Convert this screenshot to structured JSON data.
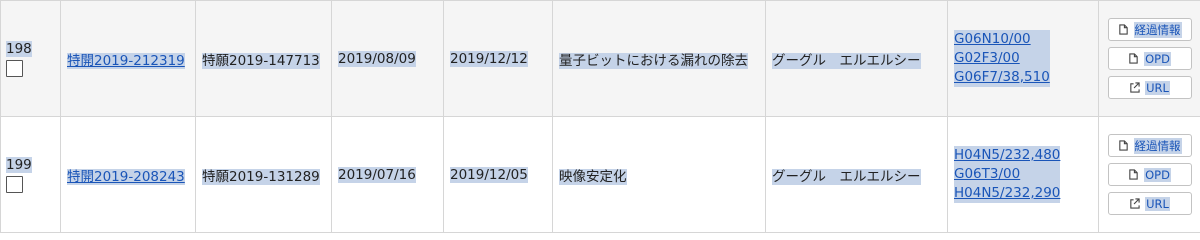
{
  "rows": [
    {
      "number": "198",
      "pub_no": "特開2019-212319",
      "app_no": "特願2019-147713",
      "app_date": "2019/08/09",
      "pub_date": "2019/12/12",
      "title": "量子ビットにおける漏れの除去",
      "applicant": "グーグル　エルエルシー",
      "classes": [
        "G06N10/00",
        "G02F3/00",
        "G06F7/38,510"
      ],
      "buttons": {
        "progress": "経過情報",
        "opd": "OPD",
        "url": "URL"
      }
    },
    {
      "number": "199",
      "pub_no": "特開2019-208243",
      "app_no": "特願2019-131289",
      "app_date": "2019/07/16",
      "pub_date": "2019/12/05",
      "title": "映像安定化",
      "applicant": "グーグル　エルエルシー",
      "classes": [
        "H04N5/232,480",
        "G06T3/00",
        "H04N5/232,290"
      ],
      "buttons": {
        "progress": "経過情報",
        "opd": "OPD",
        "url": "URL"
      }
    }
  ],
  "icons": {
    "doc": "document-icon",
    "external": "external-link-icon"
  },
  "colors": {
    "link": "#1a55b8",
    "selection": "#c5d3e8",
    "row_alt": "#f5f5f5"
  }
}
